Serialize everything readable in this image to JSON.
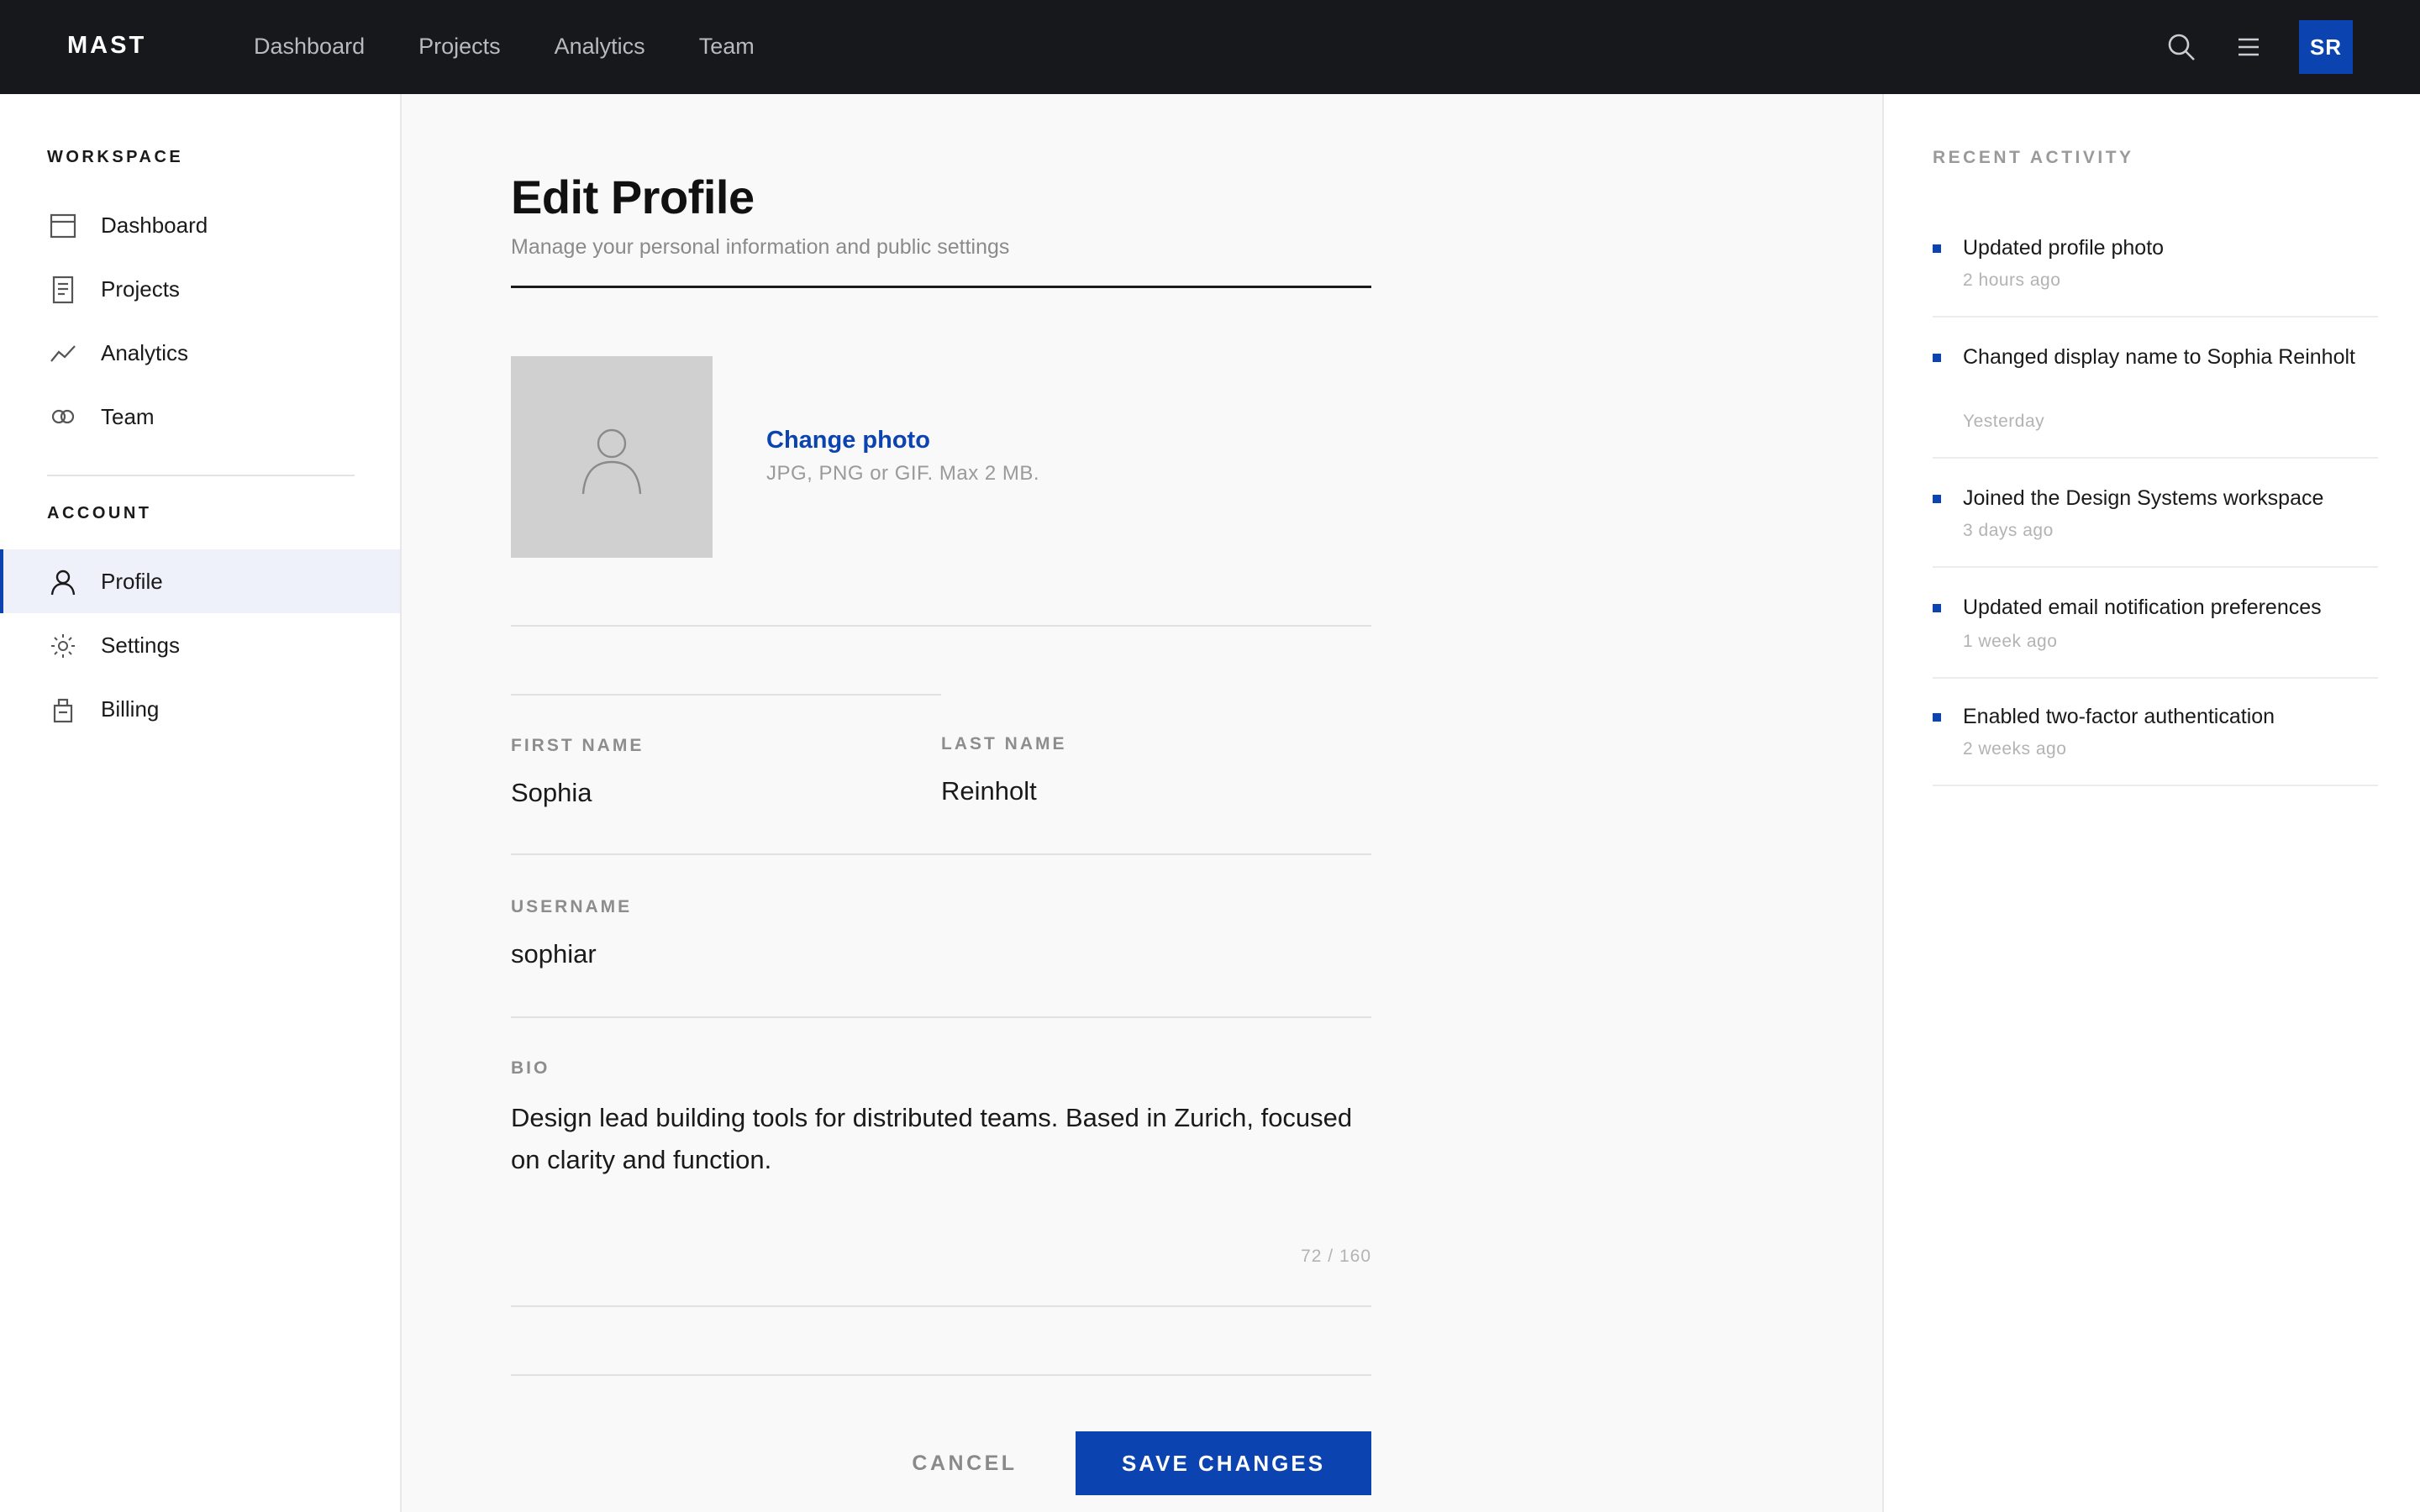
{
  "app": {
    "brand": "MAST"
  },
  "topnav": {
    "items": [
      "Dashboard",
      "Projects",
      "Analytics",
      "Team"
    ]
  },
  "user": {
    "initials": "SR"
  },
  "icons": {
    "search": "search-icon",
    "menu": "menu-icon",
    "avatar_placeholder": "user-placeholder-icon"
  },
  "sidebar": {
    "workspace_heading": "WORKSPACE",
    "workspace_items": [
      {
        "label": "Dashboard",
        "icon": "dashboard-icon"
      },
      {
        "label": "Projects",
        "icon": "document-icon"
      },
      {
        "label": "Analytics",
        "icon": "chart-line-icon"
      },
      {
        "label": "Team",
        "icon": "team-icon"
      }
    ],
    "account_heading": "ACCOUNT",
    "account_items": [
      {
        "label": "Profile",
        "icon": "user-icon",
        "active": true
      },
      {
        "label": "Settings",
        "icon": "settings-icon",
        "active": false
      },
      {
        "label": "Billing",
        "icon": "billing-icon",
        "active": false
      }
    ]
  },
  "main": {
    "title": "Edit Profile",
    "subtitle": "Manage your personal information and public settings",
    "photo": {
      "change_label": "Change photo",
      "hint": "JPG, PNG or GIF. Max 2 MB."
    },
    "fields": {
      "first_name": {
        "label": "FIRST NAME",
        "value": "Sophia"
      },
      "last_name": {
        "label": "LAST NAME",
        "value": "Reinholt"
      },
      "username": {
        "label": "USERNAME",
        "value": "sophiar"
      },
      "bio": {
        "label": "BIO",
        "value": "Design lead building tools for distributed teams. Based in Zurich, focused on clarity and function.",
        "counter": "72 / 160"
      }
    },
    "actions": {
      "cancel": "CANCEL",
      "save": "SAVE CHANGES"
    }
  },
  "activity": {
    "heading": "RECENT ACTIVITY",
    "items": [
      {
        "text": "Updated profile photo",
        "time": "2 hours ago"
      },
      {
        "text": "Changed display name to Sophia Reinholt",
        "time": "Yesterday"
      },
      {
        "text": "Joined the Design Systems workspace",
        "time": "3 days ago"
      },
      {
        "text": "Updated email notification preferences",
        "time": "1 week ago"
      },
      {
        "text": "Enabled two-factor authentication",
        "time": "2 weeks ago"
      }
    ]
  },
  "colors": {
    "accent": "#0b44b1",
    "topbar": "#16181c",
    "muted": "#8d8d8d"
  }
}
